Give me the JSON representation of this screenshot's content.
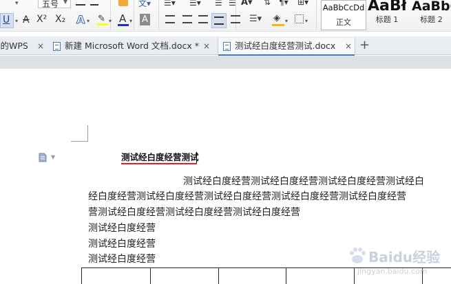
{
  "ribbon": {
    "font_size": "五号",
    "superscript": "X²",
    "subscript": "X₂",
    "styles": [
      {
        "sample": "AaBbCcDd",
        "name": "正文"
      },
      {
        "sample": "AaBł",
        "name": "标题 1"
      },
      {
        "sample": "AaBbC",
        "name": "标题 2"
      }
    ]
  },
  "tabs": [
    {
      "label": "我的WPS",
      "close": "×"
    },
    {
      "label": "新建 Microsoft Word 文档.docx *",
      "close": "×"
    },
    {
      "label": "测试经白度经营测试.docx",
      "close": "×"
    }
  ],
  "new_tab": "+",
  "document": {
    "title": "测试经白度经营测试",
    "lines": [
      "测试经白度经营测试经白度经营测试经白度经营测试经白",
      "经白度经营测试经白度经营测试经白度经营测试经白度经营测试经白度经营",
      "营测试经白度经营测试经白度经营测试经白度经营",
      "测试经白度经营",
      "测试经白度经营",
      "测试经白度经营"
    ]
  },
  "watermark": {
    "brand": "Baidu经验",
    "url": "jingyan.baidu.com"
  }
}
